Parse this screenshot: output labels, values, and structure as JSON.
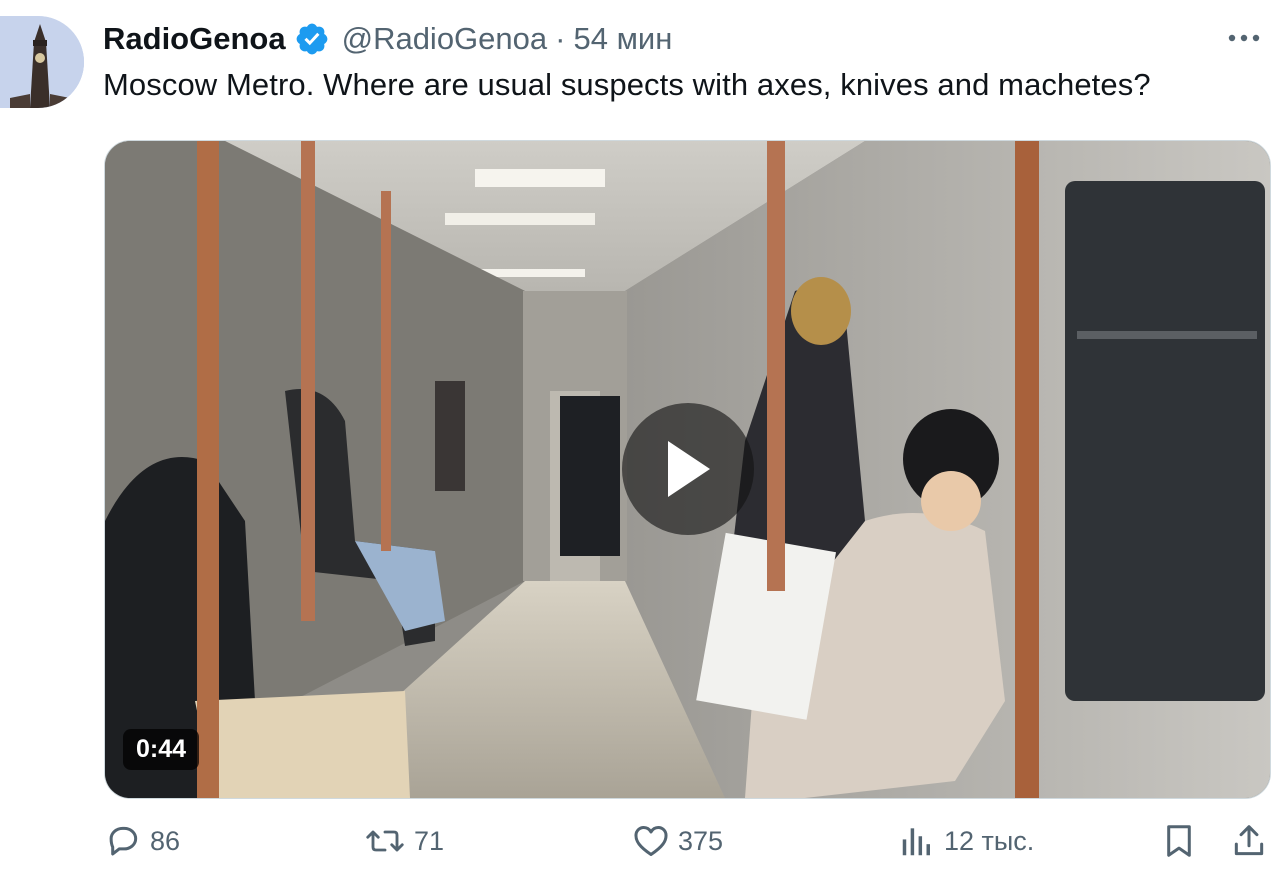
{
  "tweet": {
    "author_name": "RadioGenoa",
    "handle": "@RadioGenoa",
    "separator": "·",
    "time": "54 мин",
    "text": "Moscow Metro. Where are usual suspects with axes, knives and machetes?"
  },
  "media": {
    "type": "video",
    "duration": "0:44"
  },
  "actions": {
    "replies": "86",
    "reposts": "71",
    "likes": "375",
    "views": "12 тыс."
  },
  "icons": {
    "verified": "verified-badge-icon",
    "more": "more-horizontal-icon",
    "reply": "reply-icon",
    "repost": "repost-icon",
    "like": "heart-icon",
    "views": "views-chart-icon",
    "bookmark": "bookmark-icon",
    "share": "share-icon",
    "play": "play-icon"
  },
  "colors": {
    "verified_blue": "#1d9bf0",
    "secondary_text": "#536471",
    "primary_text": "#0f1419"
  }
}
